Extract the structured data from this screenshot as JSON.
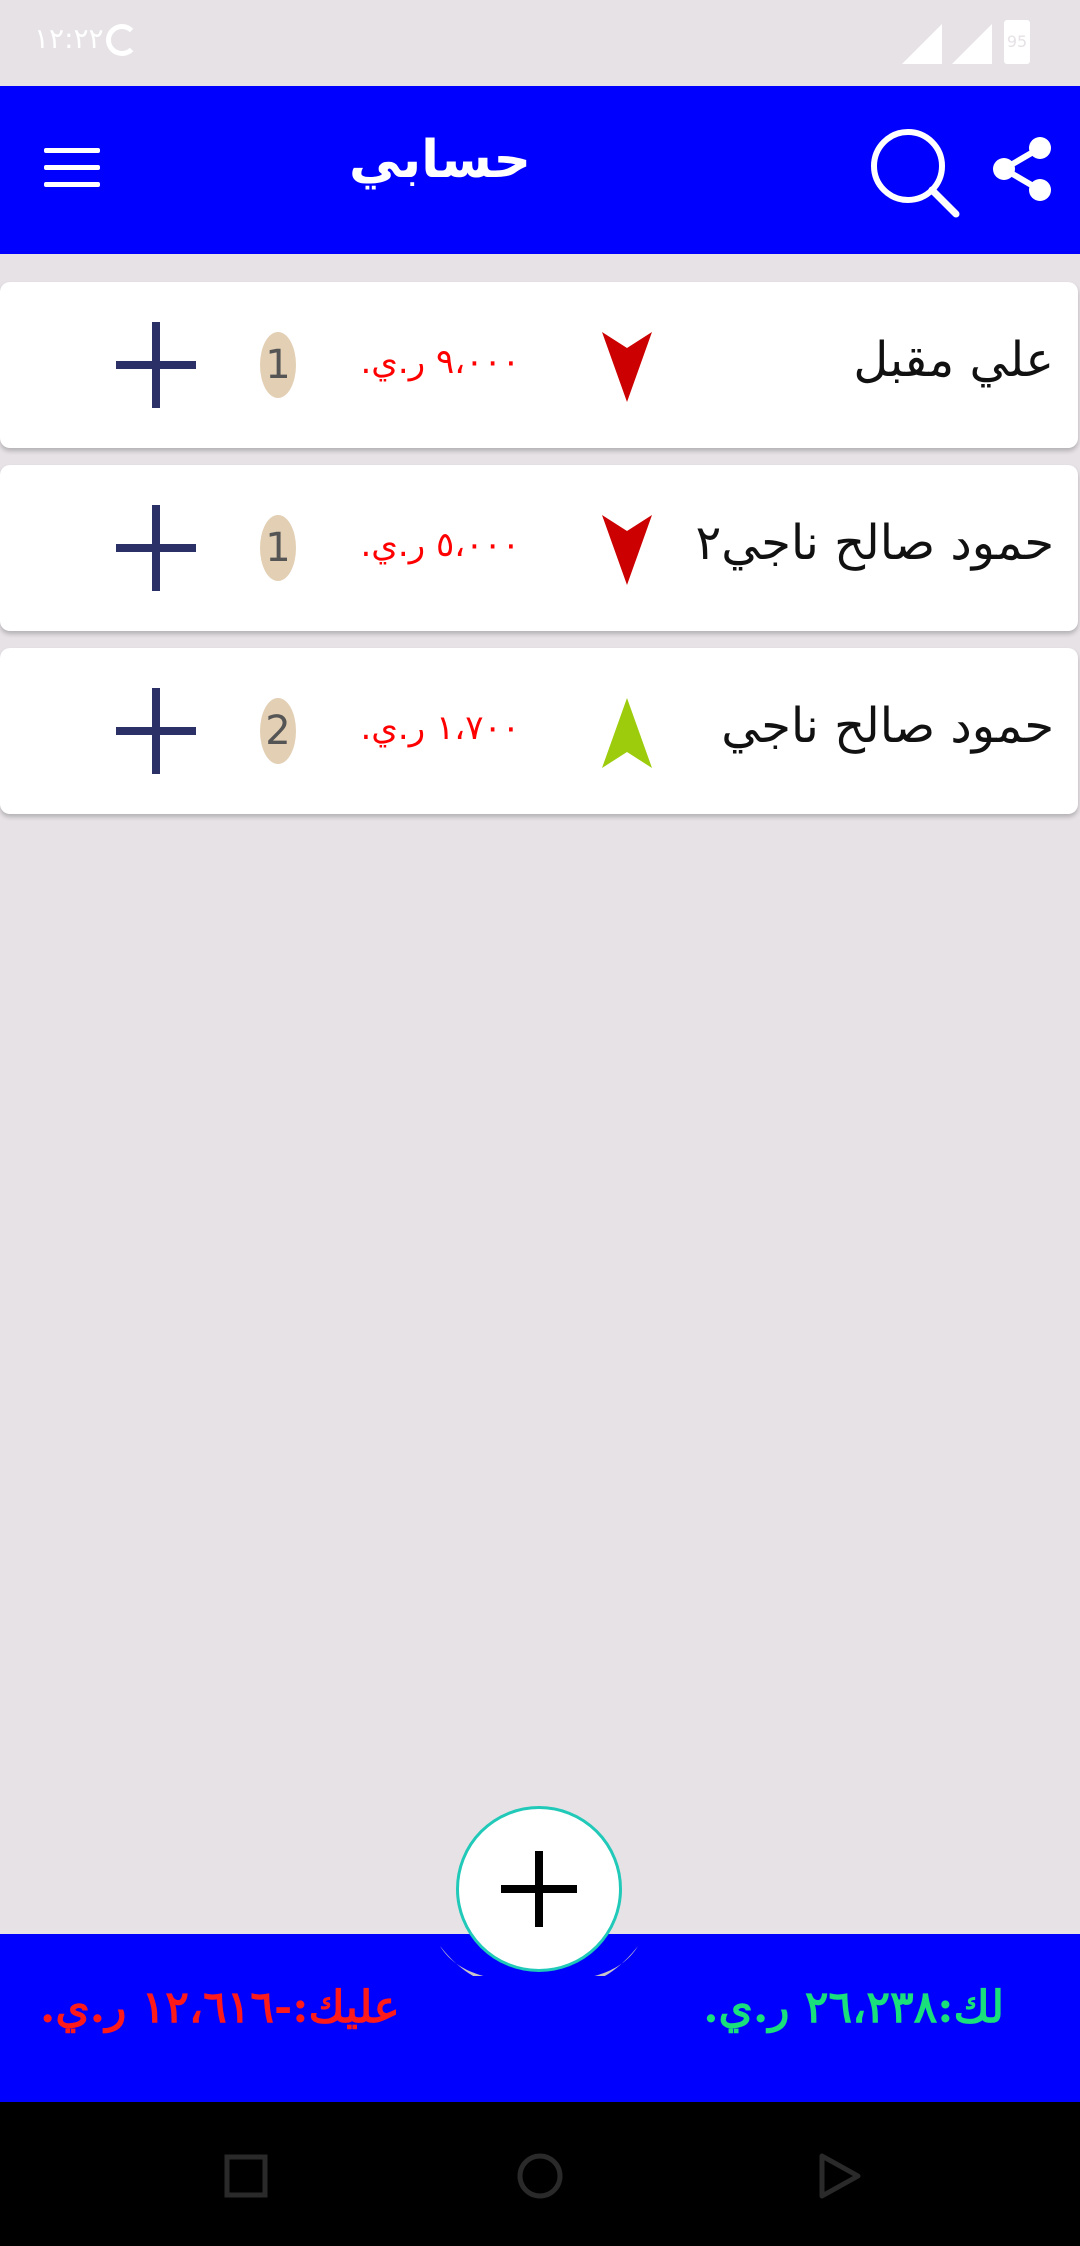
{
  "status_bar": {
    "time": "١٢:٢٢",
    "battery": "95"
  },
  "app_bar": {
    "title": "حسابي",
    "icons": [
      "menu-icon",
      "search-icon",
      "share-icon"
    ]
  },
  "accounts": [
    {
      "name": "علي مقبل",
      "amount": "٩،٠٠٠ ر.ي.",
      "count": "1",
      "trend": "down",
      "trend_color": "#cc0000"
    },
    {
      "name": "حمود صالح ناجي٢",
      "amount": "٥،٠٠٠ ر.ي.",
      "count": "1",
      "trend": "down",
      "trend_color": "#cc0000"
    },
    {
      "name": "حمود صالح ناجي",
      "amount": "١،٧٠٠ ر.ي.",
      "count": "2",
      "trend": "up",
      "trend_color": "#9ccc0c"
    }
  ],
  "summary": {
    "owed_by_you": "عليك:-١٢،٦١٦ ر.ي.",
    "owed_to_you": "لك:٢٦،٢٣٨ ر.ي."
  },
  "colors": {
    "primary": "#0000ff",
    "negative": "#ff0000",
    "positive": "#19e07a",
    "badge": "#e3cfb4"
  }
}
